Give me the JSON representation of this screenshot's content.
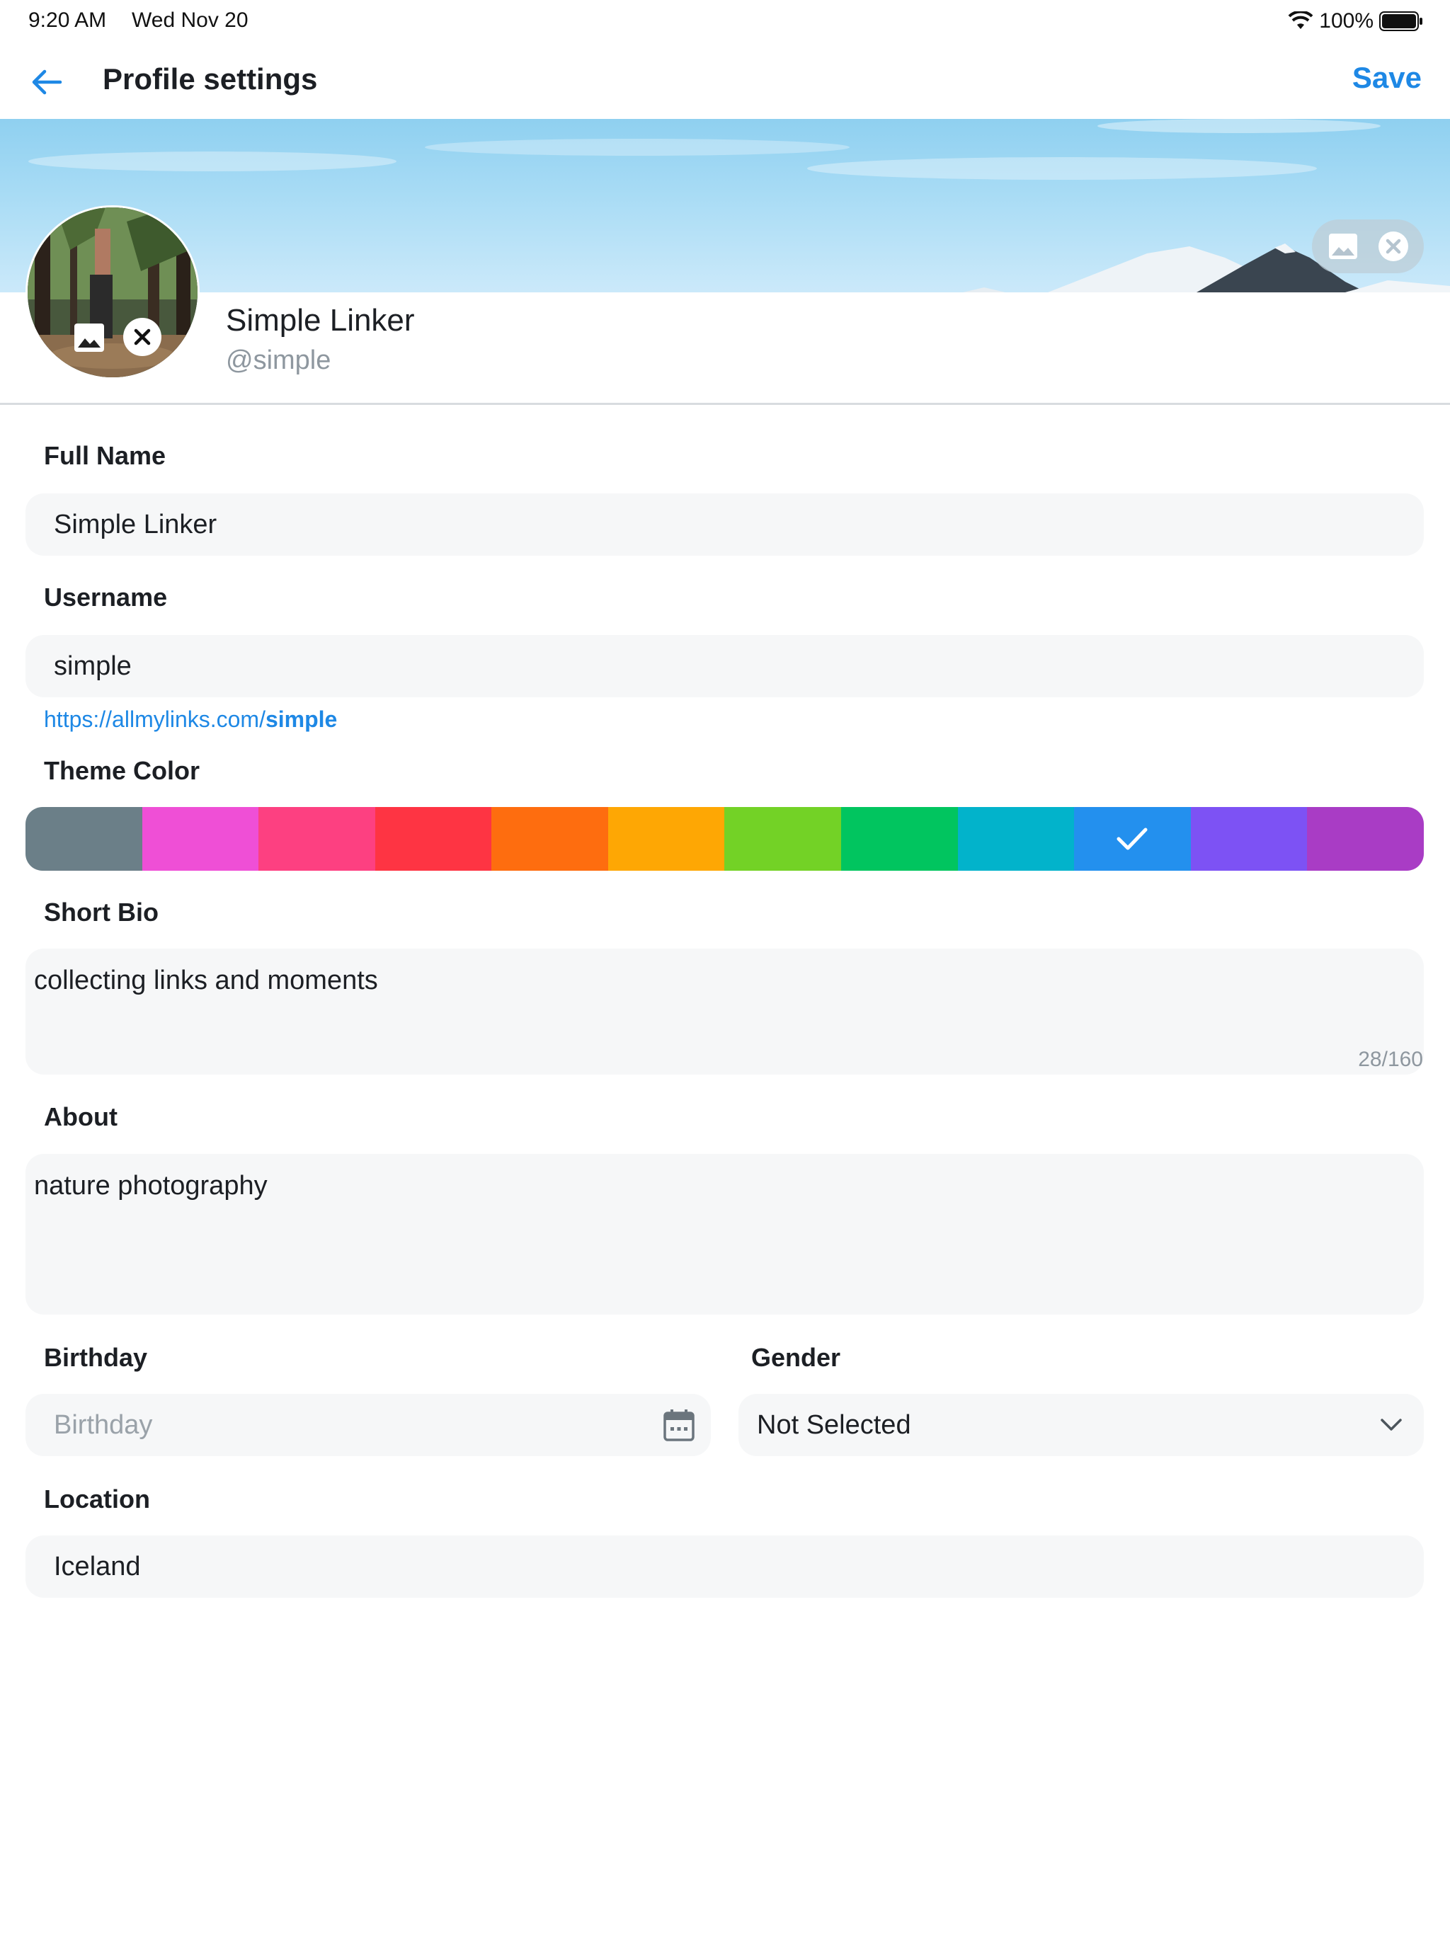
{
  "status_bar": {
    "time": "9:20 AM",
    "date": "Wed Nov 20",
    "battery": "100%"
  },
  "header": {
    "title": "Profile settings",
    "save_label": "Save"
  },
  "profile": {
    "name": "Simple Linker",
    "handle": "@simple"
  },
  "form": {
    "full_name": {
      "label": "Full Name",
      "value": "Simple Linker"
    },
    "username": {
      "label": "Username",
      "value": "simple",
      "url_prefix": "https://allmylinks.com/",
      "url_suffix": "simple"
    },
    "theme_color": {
      "label": "Theme Color",
      "colors": [
        "#6b7f88",
        "#ef4fd6",
        "#fd4081",
        "#fe3443",
        "#fe6d0f",
        "#fea704",
        "#73d226",
        "#01c55f",
        "#02b3cb",
        "#2390ee",
        "#7d52f4",
        "#a93cc5"
      ],
      "selected": "#2390ee"
    },
    "short_bio": {
      "label": "Short Bio",
      "value": "collecting links and moments",
      "counter": "28/160"
    },
    "about": {
      "label": "About",
      "value": "nature photography"
    },
    "birthday": {
      "label": "Birthday",
      "placeholder": "Birthday"
    },
    "gender": {
      "label": "Gender",
      "value": "Not Selected"
    },
    "location": {
      "label": "Location",
      "value": "Iceland"
    }
  },
  "icons": {
    "back": "arrow-left-icon",
    "cover_image": "image-icon",
    "cover_remove": "close-circle-icon",
    "avatar_image": "image-icon",
    "avatar_remove": "close-circle-icon",
    "calendar": "calendar-icon",
    "chevron": "chevron-down-icon",
    "check": "check-icon"
  }
}
